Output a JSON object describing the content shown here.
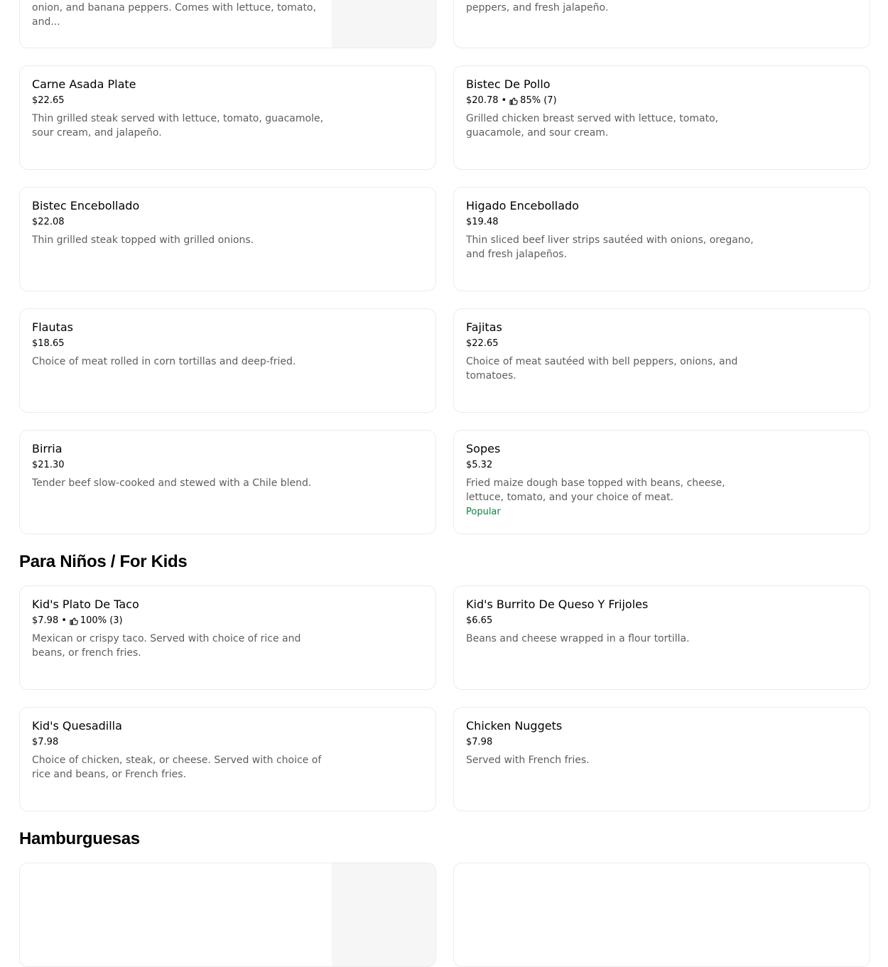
{
  "top_cards": [
    {
      "desc": "Thin grilled steak served with a cheese enchilada, sautas, onion, and banana peppers. Comes with lettuce, tomato, and..."
    },
    {
      "desc": "Thin sliced steak sautéed with salsa, onions, tomatoes, bell peppers, and fresh jalapeño."
    }
  ],
  "items": [
    {
      "name": "Carne Asada Plate",
      "price": "$22.65",
      "desc": "Thin grilled steak served with lettuce, tomato, guacamole, sour cream, and jalapeño."
    },
    {
      "name": "Bistec De Pollo",
      "price": "$20.78",
      "rating": "85% (7)",
      "desc": "Grilled chicken breast served with lettuce, tomato, guacamole, and sour cream."
    },
    {
      "name": "Bistec Encebollado",
      "price": "$22.08",
      "desc": "Thin grilled steak topped with grilled onions."
    },
    {
      "name": "Higado Encebollado",
      "price": "$19.48",
      "desc": "Thin sliced beef liver strips sautéed with onions, oregano, and fresh jalapeños."
    },
    {
      "name": "Flautas",
      "price": "$18.65",
      "desc": "Choice of meat rolled in corn tortillas and deep-fried."
    },
    {
      "name": "Fajitas",
      "price": "$22.65",
      "desc": "Choice of meat sautéed with bell peppers, onions, and tomatoes."
    },
    {
      "name": "Birria",
      "price": "$21.30",
      "desc": "Tender beef slow-cooked and stewed with a Chile blend."
    },
    {
      "name": "Sopes",
      "price": "$5.32",
      "desc": "Fried maize dough base topped with beans, cheese, lettuce, tomato, and your choice of meat.",
      "badge": "Popular"
    }
  ],
  "sections": [
    {
      "title": "Para Niños / For Kids",
      "items": [
        {
          "name": "Kid's Plato De Taco",
          "price": "$7.98",
          "rating": "100% (3)",
          "desc": "Mexican or crispy taco. Served with choice of rice and beans, or french fries."
        },
        {
          "name": "Kid's Burrito De Queso Y Frijoles",
          "price": "$6.65",
          "desc": "Beans and cheese wrapped in a flour tortilla."
        },
        {
          "name": "Kid's Quesadilla",
          "price": "$7.98",
          "desc": "Choice of chicken, steak, or cheese. Served with choice of rice and beans, or French fries."
        },
        {
          "name": "Chicken Nuggets",
          "price": "$7.98",
          "desc": "Served with French fries."
        }
      ]
    },
    {
      "title": "Hamburguesas"
    }
  ],
  "separator": "•",
  "colors": {
    "badge": "#0e8345",
    "description": "#5e5e5e",
    "border": "#ececec"
  },
  "icons": {
    "rating": "thumbs-up-icon"
  }
}
